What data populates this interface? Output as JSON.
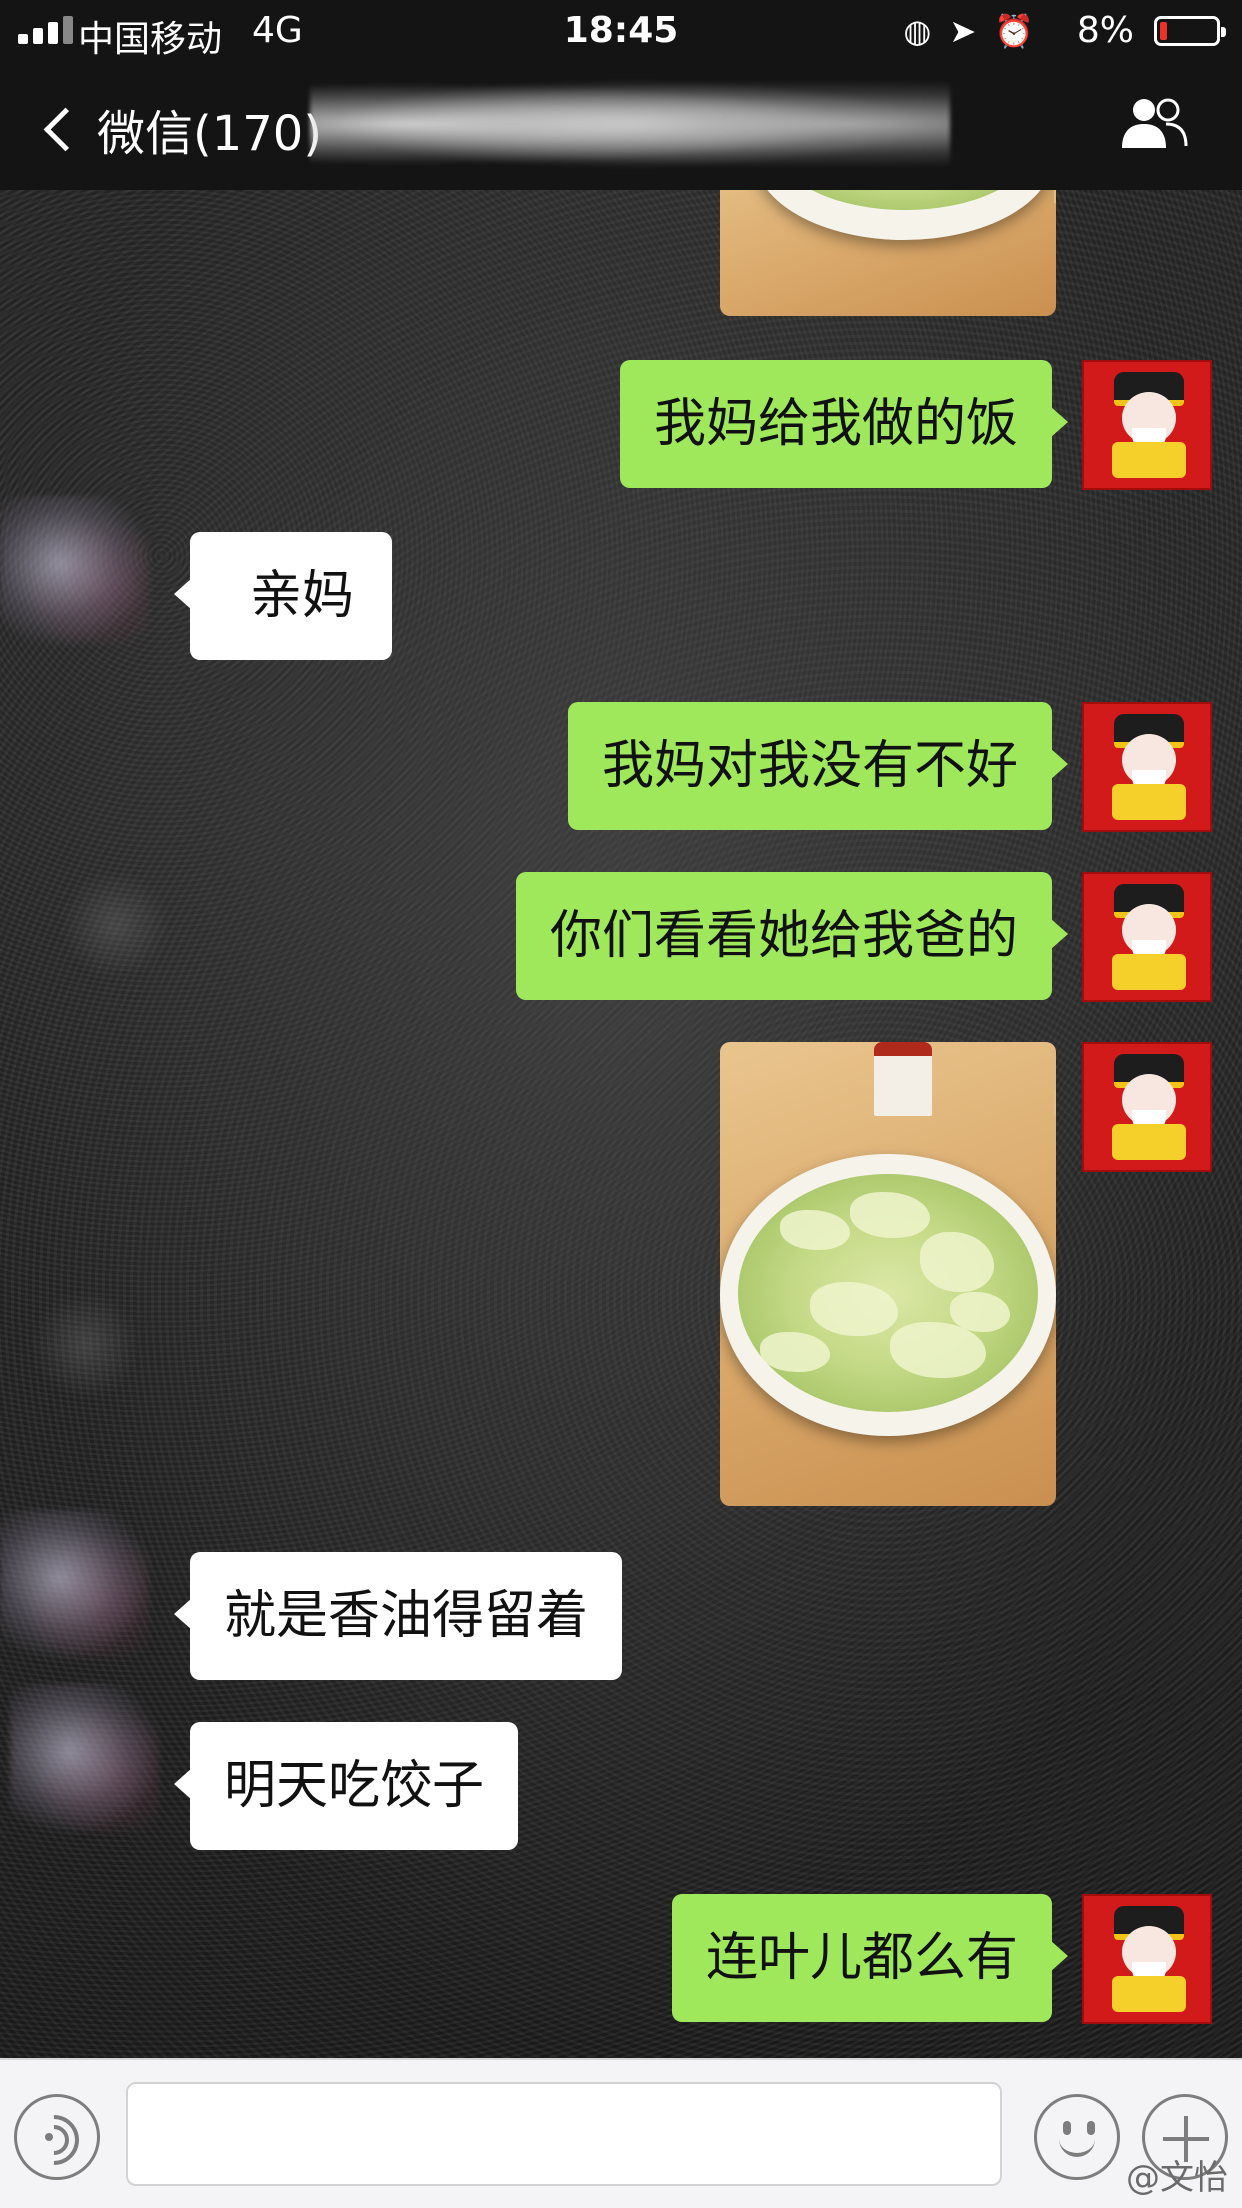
{
  "status_bar": {
    "carrier": "中国移动",
    "network": "4G",
    "time": "18:45",
    "battery": "8%"
  },
  "nav": {
    "back_label": "微信(170)"
  },
  "messages": [
    {
      "side": "right",
      "type": "image",
      "alt": "food photo (partial)"
    },
    {
      "side": "right",
      "type": "text",
      "text": "我妈给我做的饭"
    },
    {
      "side": "left",
      "type": "text",
      "text": "亲妈"
    },
    {
      "side": "right",
      "type": "text",
      "text": "我妈对我没有不好"
    },
    {
      "side": "right",
      "type": "text",
      "text": "你们看看她给我爸的"
    },
    {
      "side": "right",
      "type": "image",
      "alt": "bowl of cabbage soup"
    },
    {
      "side": "left",
      "type": "text",
      "text": "就是香油得留着"
    },
    {
      "side": "left",
      "type": "text",
      "text": "明天吃饺子"
    },
    {
      "side": "right",
      "type": "text",
      "text": "连叶儿都么有"
    }
  ],
  "input_bar": {
    "value": ""
  },
  "watermark": "@文怡",
  "colors": {
    "bubble_right": "#9fe75b",
    "bubble_left": "#ffffff",
    "topbar": "#141414",
    "battery_low": "#e8332a"
  },
  "icons": [
    "signal-icon",
    "alarm-icon",
    "location-icon",
    "battery-icon",
    "back-chevron-icon",
    "group-members-icon",
    "voice-icon",
    "emoji-icon",
    "plus-icon"
  ]
}
